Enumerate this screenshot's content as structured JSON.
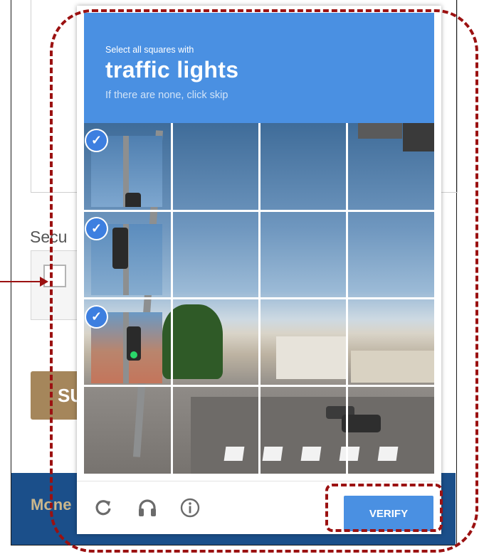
{
  "background": {
    "security_label": "Secu",
    "submit_label": "SU",
    "footer_text": "Mone"
  },
  "captcha": {
    "instruction": "Select all squares with",
    "target": "traffic lights",
    "hint": "If there are none, click skip",
    "selected_tiles": [
      1,
      2,
      3
    ],
    "check_mark": "✓",
    "verify_label": "VERIFY",
    "icons": {
      "reload": "reload-icon",
      "audio": "headphones-icon",
      "info": "info-icon"
    },
    "colors": {
      "header_blue": "#4a90e2",
      "annotation_red": "#9b1111",
      "submit_gold": "#a5865b",
      "footer_navy": "#1b4f8a"
    }
  }
}
